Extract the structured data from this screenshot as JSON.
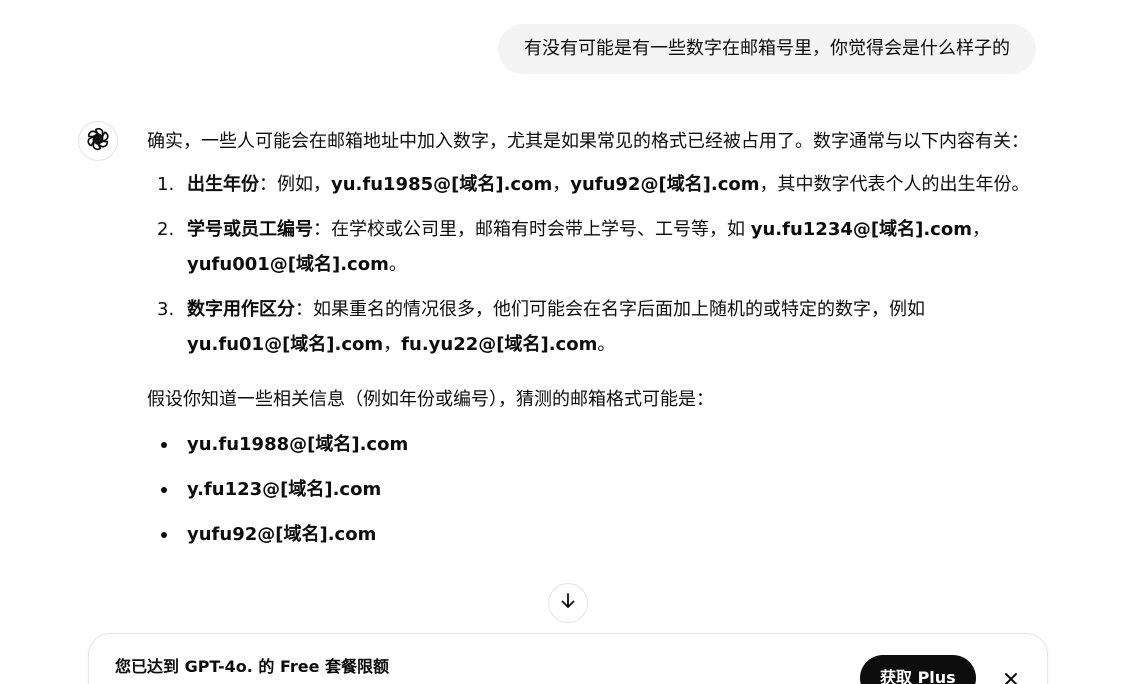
{
  "user_message": "有没有可能是有一些数字在邮箱号里，你觉得会是什么样子的",
  "assistant": {
    "avatar_icon": "openai-logo-icon",
    "intro": "确实，一些人可能会在邮箱地址中加入数字，尤其是如果常见的格式已经被占用了。数字通常与以下内容有关：",
    "numbered": [
      {
        "n": "1.",
        "title": "出生年份",
        "sep": "：例如，",
        "ex1": "yu.fu1985@[域名].com",
        "mid": "，",
        "ex2": "yufu92@[域名].com",
        "tail": "，其中数字代表个人的出生年份。"
      },
      {
        "n": "2.",
        "title": "学号或员工编号",
        "sep": "：在学校或公司里，邮箱有时会带上学号、工号等，如 ",
        "ex1": "yu.fu1234@[域名].com",
        "mid": "，",
        "ex2": "yufu001@[域名].com",
        "tail": "。"
      },
      {
        "n": "3.",
        "title": "数字用作区分",
        "sep": "：如果重名的情况很多，他们可能会在名字后面加上随机的或特定的数字，例如 ",
        "ex1": "yu.fu01@[域名].com",
        "mid": "，",
        "ex2": "fu.yu22@[域名].com",
        "tail": "。"
      }
    ],
    "intro2": "假设你知道一些相关信息（例如年份或编号），猜测的邮箱格式可能是：",
    "bullets": [
      "yu.fu1988@[域名].com",
      "y.fu123@[域名].com",
      "yufu92@[域名].com"
    ]
  },
  "scroll_down_icon": "arrow-down-icon",
  "limit_banner": {
    "title": "您已达到 GPT-4o. 的 Free 套餐限额",
    "subtitle": "",
    "button_label": "获取 Plus",
    "close_icon": "close-icon"
  }
}
